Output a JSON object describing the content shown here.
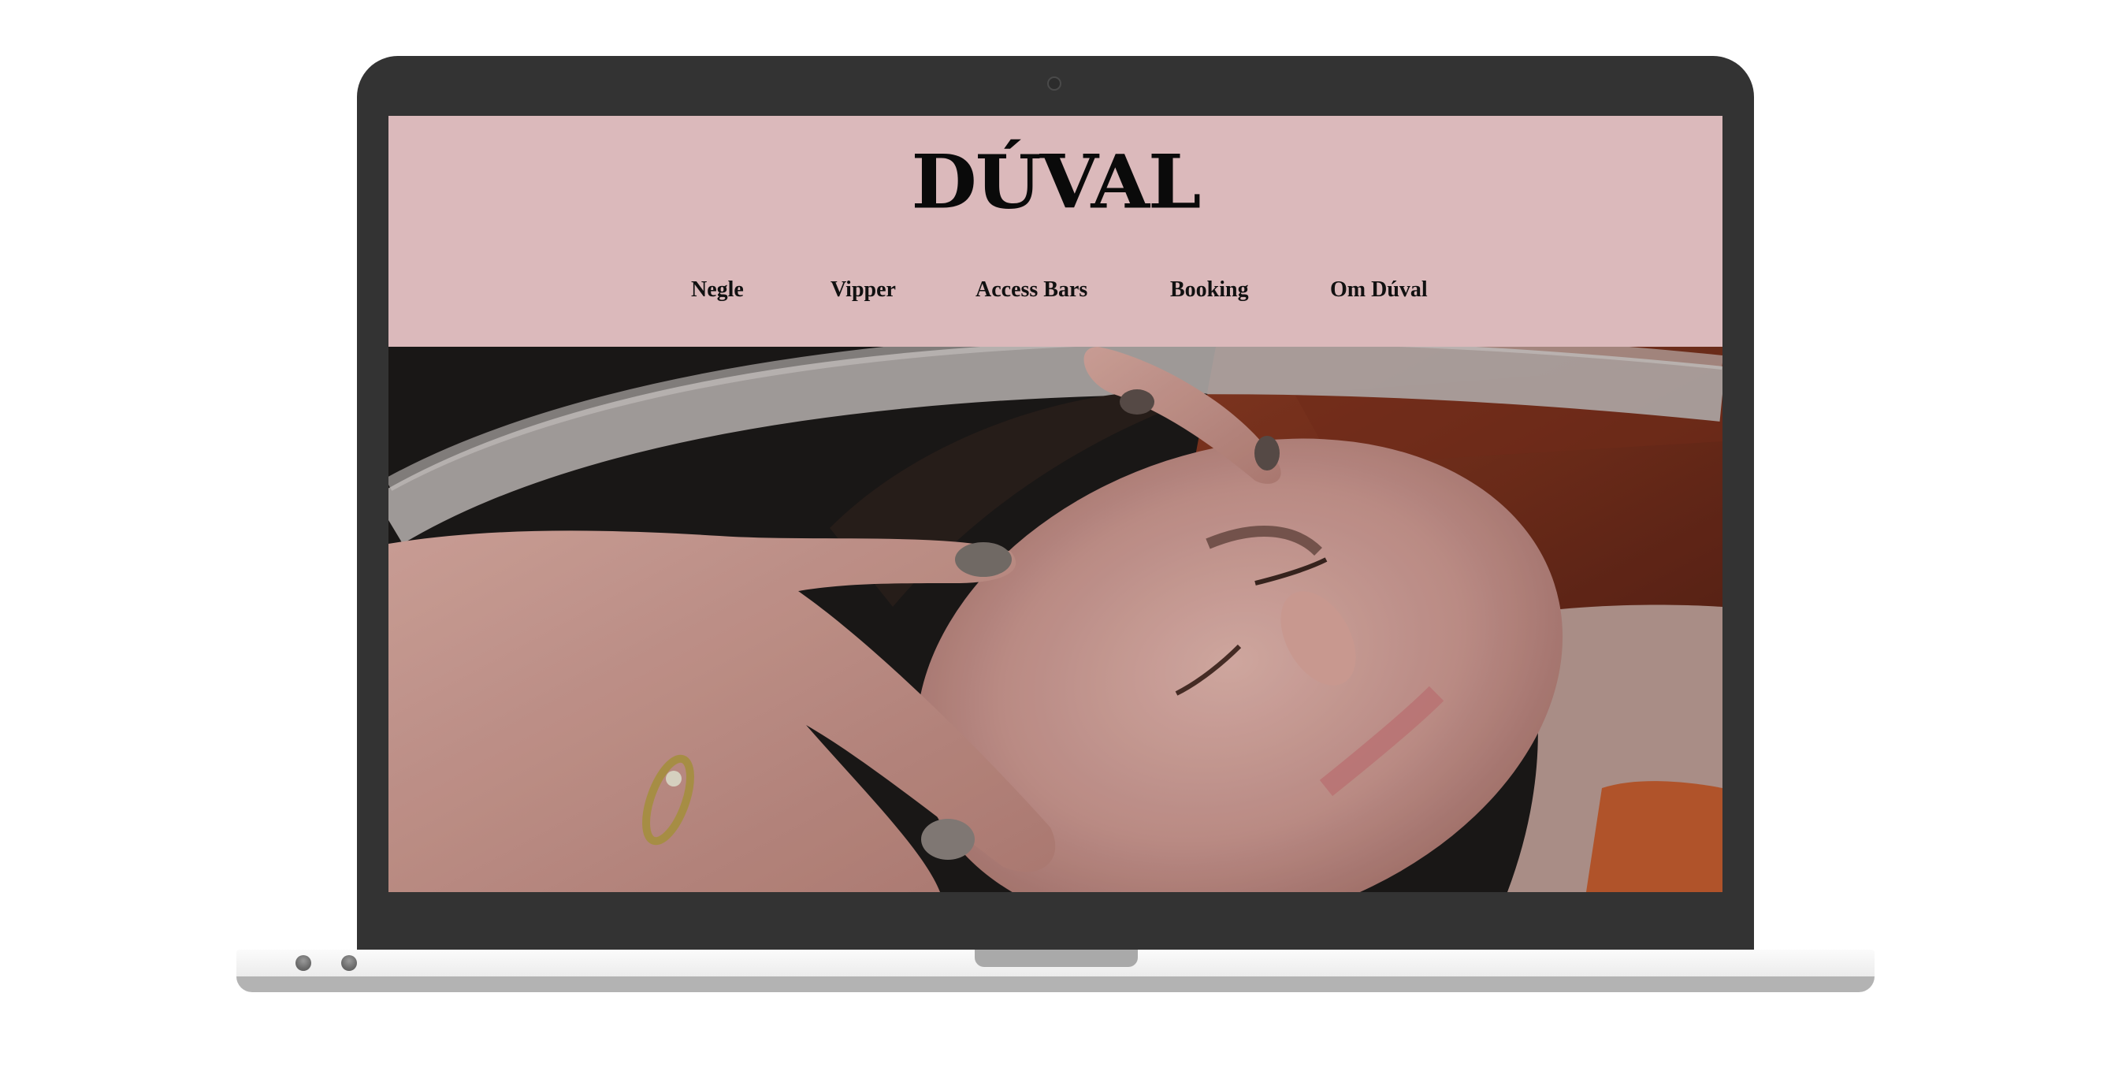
{
  "site": {
    "logo": "DÚVAL",
    "nav": [
      {
        "label": "Negle"
      },
      {
        "label": "Vipper"
      },
      {
        "label": "Access Bars"
      },
      {
        "label": "Booking"
      },
      {
        "label": "Om Dúval"
      }
    ]
  },
  "hero": {
    "icon": "hero-photo"
  },
  "colors": {
    "header_bg": "#dbb9bb",
    "laptop_frame": "#333333"
  }
}
